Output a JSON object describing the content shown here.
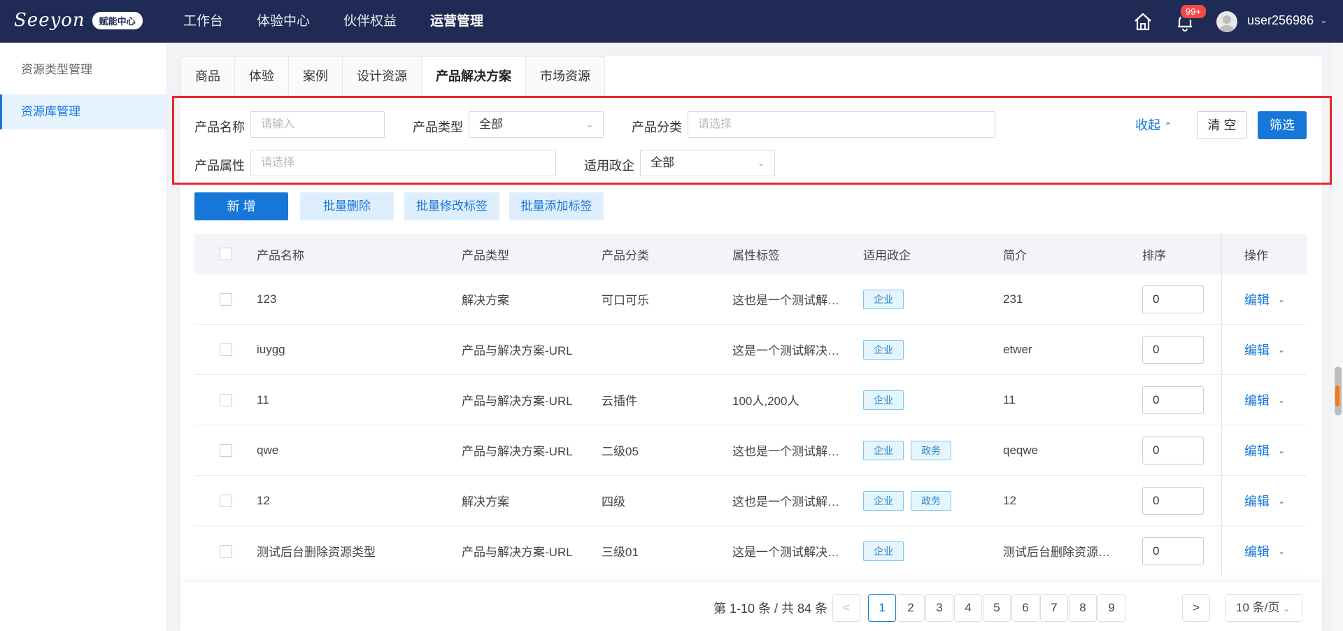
{
  "topbar": {
    "logo_text": "Seeyon",
    "logo_badge": "赋能中心",
    "nav": [
      "工作台",
      "体验中心",
      "伙伴权益",
      "运营管理"
    ],
    "active_nav": "运营管理",
    "notification_count": "99+",
    "username": "user256986"
  },
  "sidebar": {
    "items": [
      "资源类型管理",
      "资源库管理"
    ],
    "active": "资源库管理"
  },
  "tabs": [
    "商品",
    "体验",
    "案例",
    "设计资源",
    "产品解决方案",
    "市场资源"
  ],
  "active_tab": "产品解决方案",
  "filters": {
    "name_label": "产品名称",
    "name_placeholder": "请输入",
    "type_label": "产品类型",
    "type_value": "全部",
    "category_label": "产品分类",
    "category_placeholder": "请选择",
    "attr_label": "产品属性",
    "attr_placeholder": "请选择",
    "policy_label": "适用政企",
    "policy_value": "全部",
    "collapse_label": "收起",
    "clear_label": "清 空",
    "filter_label": "筛选"
  },
  "actions": {
    "add": "新 增",
    "batch_delete": "批量删除",
    "batch_edit_tags": "批量修改标签",
    "batch_add_tags": "批量添加标签"
  },
  "table": {
    "headers": [
      "产品名称",
      "产品类型",
      "产品分类",
      "属性标签",
      "适用政企",
      "简介",
      "排序",
      "操作"
    ],
    "rows": [
      {
        "name": "123",
        "type": "解决方案",
        "category": "可口可乐",
        "tags": "这也是一个测试解…",
        "policy": [
          "企业"
        ],
        "intro": "231",
        "sort": "0",
        "op": "编辑"
      },
      {
        "name": "iuygg",
        "type": "产品与解决方案-URL",
        "category": "",
        "tags": "这是一个测试解决…",
        "policy": [
          "企业"
        ],
        "intro": "etwer",
        "sort": "0",
        "op": "编辑"
      },
      {
        "name": "11",
        "type": "产品与解决方案-URL",
        "category": "云插件",
        "tags": "100人,200人",
        "policy": [
          "企业"
        ],
        "intro": "11",
        "sort": "0",
        "op": "编辑"
      },
      {
        "name": "qwe",
        "type": "产品与解决方案-URL",
        "category": "二级05",
        "tags": "这也是一个测试解…",
        "policy": [
          "企业",
          "政务"
        ],
        "intro": "qeqwe",
        "sort": "0",
        "op": "编辑"
      },
      {
        "name": "12",
        "type": "解决方案",
        "category": "四级",
        "tags": "这也是一个测试解…",
        "policy": [
          "企业",
          "政务"
        ],
        "intro": "12",
        "sort": "0",
        "op": "编辑"
      },
      {
        "name": "测试后台删除资源类型",
        "type": "产品与解决方案-URL",
        "category": "三级01",
        "tags": "这是一个测试解决…",
        "policy": [
          "企业"
        ],
        "intro": "测试后台删除资源…",
        "sort": "0",
        "op": "编辑"
      }
    ]
  },
  "pagination": {
    "total_text": "第 1-10 条 / 共 84 条",
    "prev": "<",
    "next": ">",
    "pages": [
      "1",
      "2",
      "3",
      "4",
      "5",
      "6",
      "7",
      "8",
      "9"
    ],
    "current": "1",
    "page_size": "10 条/页"
  },
  "colors": {
    "primary": "#1677d8",
    "nav_bg": "#1f2b55",
    "highlight_frame": "#e8262b"
  }
}
